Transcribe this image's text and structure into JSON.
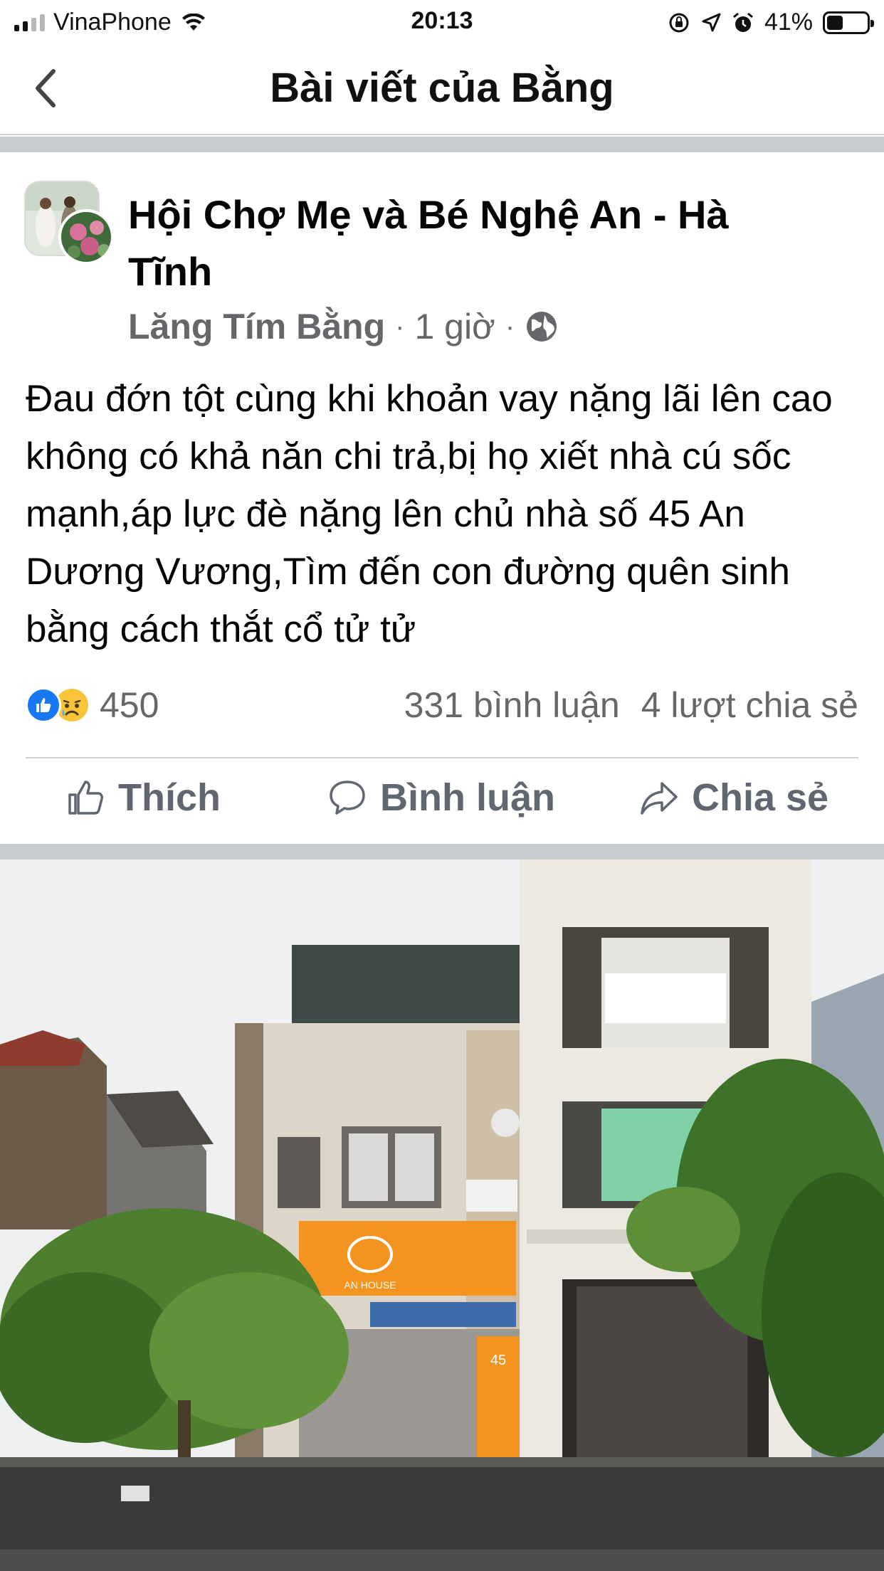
{
  "status_bar": {
    "carrier": "VinaPhone",
    "time": "20:13",
    "battery_percent": "41%",
    "battery_level": 0.41
  },
  "header": {
    "title": "Bài viết của Bằng",
    "back_icon": "chevron-left-icon"
  },
  "post": {
    "group_name": "Hội Chợ Mẹ và Bé Nghệ An - Hà Tĩnh",
    "author": "Lăng Tím Bằng",
    "time": "1 giờ",
    "text": "Đau đớn tột cùng khi khoản vay nặng lãi lên cao không có khả năn chi trả,bị họ xiết nhà cú sốc mạnh,áp lực đè nặng lên chủ nhà số 45 An Dương Vương,Tìm đến con đường quên sinh bằng cách thắt cổ tử tử",
    "reaction_count": "450",
    "comments": "331 bình luận",
    "shares": "4 lượt chia sẻ"
  },
  "actions": {
    "like": "Thích",
    "comment": "Bình luận",
    "share": "Chia sẻ"
  },
  "photo_signs": {
    "cafe_name": "AN HOUSE",
    "house_number": "45"
  },
  "colors": {
    "facebook_blue": "#1877f2",
    "secondary_text": "#65676b",
    "separator": "#c9ccd1"
  }
}
